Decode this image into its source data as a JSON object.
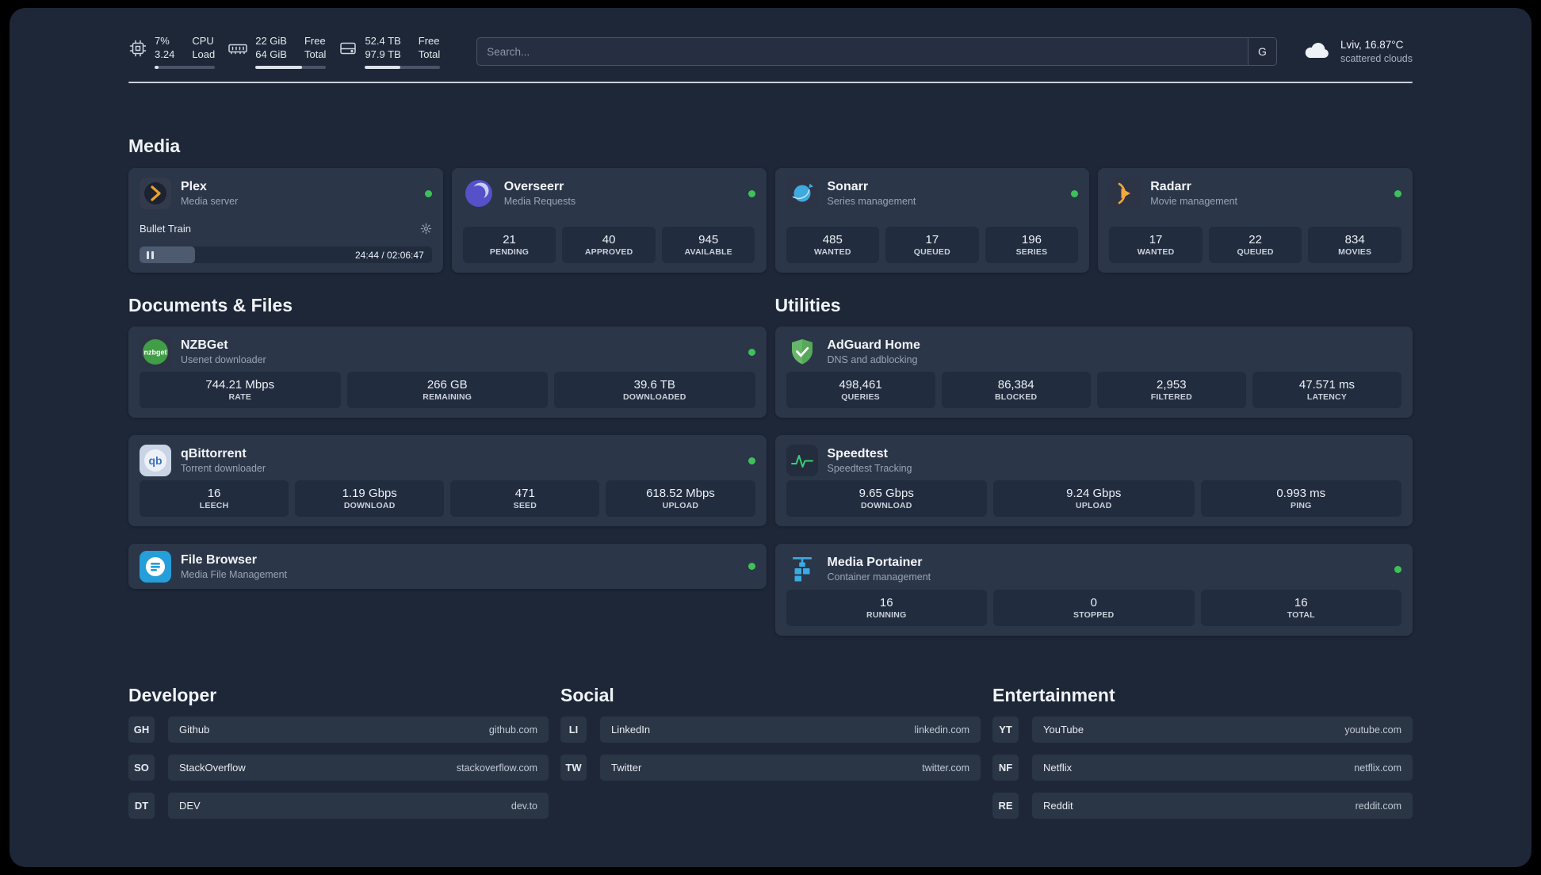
{
  "colors": {
    "status_green": "#3ec15a",
    "plex_amber": "#e8a22c",
    "overseerr_purple": "#5551c9",
    "sonarr_blue": "#3fa9e0",
    "radarr_amber": "#f3a83a",
    "nzbget_green": "#3f9e46",
    "adguard_green": "#67b768",
    "filebrowser_blue": "#259ed9",
    "speedtest_green": "#3bcf73",
    "portainer_blue": "#3aabe3"
  },
  "topbar": {
    "cpu": {
      "percent": "7%",
      "load": "3.24",
      "label1": "CPU",
      "label2": "Load",
      "usage": 7
    },
    "ram": {
      "free": "22 GiB",
      "total": "64 GiB",
      "label1": "Free",
      "label2": "Total",
      "usage": 66
    },
    "disk": {
      "free": "52.4 TB",
      "total": "97.9 TB",
      "label1": "Free",
      "label2": "Total",
      "usage": 47
    },
    "search": {
      "placeholder": "Search...",
      "engine": "G"
    },
    "weather": {
      "location": "Lviv, 16.87°C",
      "condition": "scattered clouds"
    }
  },
  "sections": {
    "media": {
      "title": "Media",
      "plex": {
        "name": "Plex",
        "desc": "Media server",
        "track": "Bullet Train",
        "time": "24:44 / 02:06:47",
        "progress": 19
      },
      "overseerr": {
        "name": "Overseerr",
        "desc": "Media Requests",
        "stats": [
          {
            "value": "21",
            "label": "PENDING"
          },
          {
            "value": "40",
            "label": "APPROVED"
          },
          {
            "value": "945",
            "label": "AVAILABLE"
          }
        ]
      },
      "sonarr": {
        "name": "Sonarr",
        "desc": "Series management",
        "stats": [
          {
            "value": "485",
            "label": "WANTED"
          },
          {
            "value": "17",
            "label": "QUEUED"
          },
          {
            "value": "196",
            "label": "SERIES"
          }
        ]
      },
      "radarr": {
        "name": "Radarr",
        "desc": "Movie management",
        "stats": [
          {
            "value": "17",
            "label": "WANTED"
          },
          {
            "value": "22",
            "label": "QUEUED"
          },
          {
            "value": "834",
            "label": "MOVIES"
          }
        ]
      }
    },
    "documents": {
      "title": "Documents & Files",
      "nzbget": {
        "name": "NZBGet",
        "desc": "Usenet downloader",
        "stats": [
          {
            "value": "744.21 Mbps",
            "label": "RATE"
          },
          {
            "value": "266 GB",
            "label": "REMAINING"
          },
          {
            "value": "39.6 TB",
            "label": "DOWNLOADED"
          }
        ]
      },
      "qbittorrent": {
        "name": "qBittorrent",
        "desc": "Torrent downloader",
        "stats": [
          {
            "value": "16",
            "label": "LEECH"
          },
          {
            "value": "1.19 Gbps",
            "label": "DOWNLOAD"
          },
          {
            "value": "471",
            "label": "SEED"
          },
          {
            "value": "618.52 Mbps",
            "label": "UPLOAD"
          }
        ]
      },
      "filebrowser": {
        "name": "File Browser",
        "desc": "Media File Management"
      }
    },
    "utilities": {
      "title": "Utilities",
      "adguard": {
        "name": "AdGuard Home",
        "desc": "DNS and adblocking",
        "stats": [
          {
            "value": "498,461",
            "label": "QUERIES"
          },
          {
            "value": "86,384",
            "label": "BLOCKED"
          },
          {
            "value": "2,953",
            "label": "FILTERED"
          },
          {
            "value": "47.571 ms",
            "label": "LATENCY"
          }
        ]
      },
      "speedtest": {
        "name": "Speedtest",
        "desc": "Speedtest Tracking",
        "stats": [
          {
            "value": "9.65 Gbps",
            "label": "DOWNLOAD"
          },
          {
            "value": "9.24 Gbps",
            "label": "UPLOAD"
          },
          {
            "value": "0.993 ms",
            "label": "PING"
          }
        ]
      },
      "portainer": {
        "name": "Media Portainer",
        "desc": "Container management",
        "stats": [
          {
            "value": "16",
            "label": "RUNNING"
          },
          {
            "value": "0",
            "label": "STOPPED"
          },
          {
            "value": "16",
            "label": "TOTAL"
          }
        ]
      }
    }
  },
  "bookmarks": {
    "developer": {
      "title": "Developer",
      "links": [
        {
          "abbr": "GH",
          "name": "Github",
          "domain": "github.com"
        },
        {
          "abbr": "SO",
          "name": "StackOverflow",
          "domain": "stackoverflow.com"
        },
        {
          "abbr": "DT",
          "name": "DEV",
          "domain": "dev.to"
        }
      ]
    },
    "social": {
      "title": "Social",
      "links": [
        {
          "abbr": "LI",
          "name": "LinkedIn",
          "domain": "linkedin.com"
        },
        {
          "abbr": "TW",
          "name": "Twitter",
          "domain": "twitter.com"
        }
      ]
    },
    "entertainment": {
      "title": "Entertainment",
      "links": [
        {
          "abbr": "YT",
          "name": "YouTube",
          "domain": "youtube.com"
        },
        {
          "abbr": "NF",
          "name": "Netflix",
          "domain": "netflix.com"
        },
        {
          "abbr": "RE",
          "name": "Reddit",
          "domain": "reddit.com"
        }
      ]
    }
  }
}
